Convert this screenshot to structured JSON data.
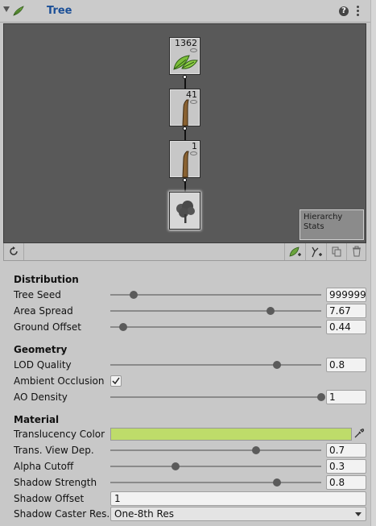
{
  "header": {
    "title": "Tree",
    "help_glyph": "?"
  },
  "viewport": {
    "nodes": [
      {
        "count": "1362",
        "icon": "leaves-icon"
      },
      {
        "count": "41",
        "icon": "branch-icon"
      },
      {
        "count": "1",
        "icon": "branch-icon"
      },
      {
        "count": "",
        "icon": "tree-icon"
      }
    ],
    "stats_lines": [
      "Hierarchy",
      "Stats"
    ]
  },
  "toolbar": {
    "buttons": [
      "refresh-icon",
      "add-leaf-group-icon",
      "add-branch-group-icon",
      "duplicate-icon",
      "delete-icon"
    ]
  },
  "distribution": {
    "title": "Distribution",
    "tree_seed": {
      "label": "Tree Seed",
      "value": "999999",
      "slider": 0.11
    },
    "area_spread": {
      "label": "Area Spread",
      "value": "7.67",
      "slider": 0.76
    },
    "ground_offset": {
      "label": "Ground Offset",
      "value": "0.44",
      "slider": 0.06
    }
  },
  "geometry": {
    "title": "Geometry",
    "lod_quality": {
      "label": "LOD Quality",
      "value": "0.8",
      "slider": 0.79
    },
    "ambient_occlusion": {
      "label": "Ambient Occlusion",
      "checked": true
    },
    "ao_density": {
      "label": "AO Density",
      "value": "1",
      "slider": 1.0
    }
  },
  "material": {
    "title": "Material",
    "translucency_color": {
      "label": "Translucency Color",
      "color": "#bedc6a"
    },
    "trans_view_dep": {
      "label": "Trans. View Dep.",
      "value": "0.7",
      "slider": 0.69
    },
    "alpha_cutoff": {
      "label": "Alpha Cutoff",
      "value": "0.3",
      "slider": 0.31
    },
    "shadow_strength": {
      "label": "Shadow Strength",
      "value": "0.8",
      "slider": 0.79
    },
    "shadow_offset": {
      "label": "Shadow Offset",
      "value": "1"
    },
    "shadow_caster_res": {
      "label": "Shadow Caster Res.",
      "value": "One-8th Res"
    }
  },
  "colors": {
    "title_blue": "#1b4f97",
    "viewport_bg": "#595959",
    "panel_bg": "#c8c8c8"
  }
}
